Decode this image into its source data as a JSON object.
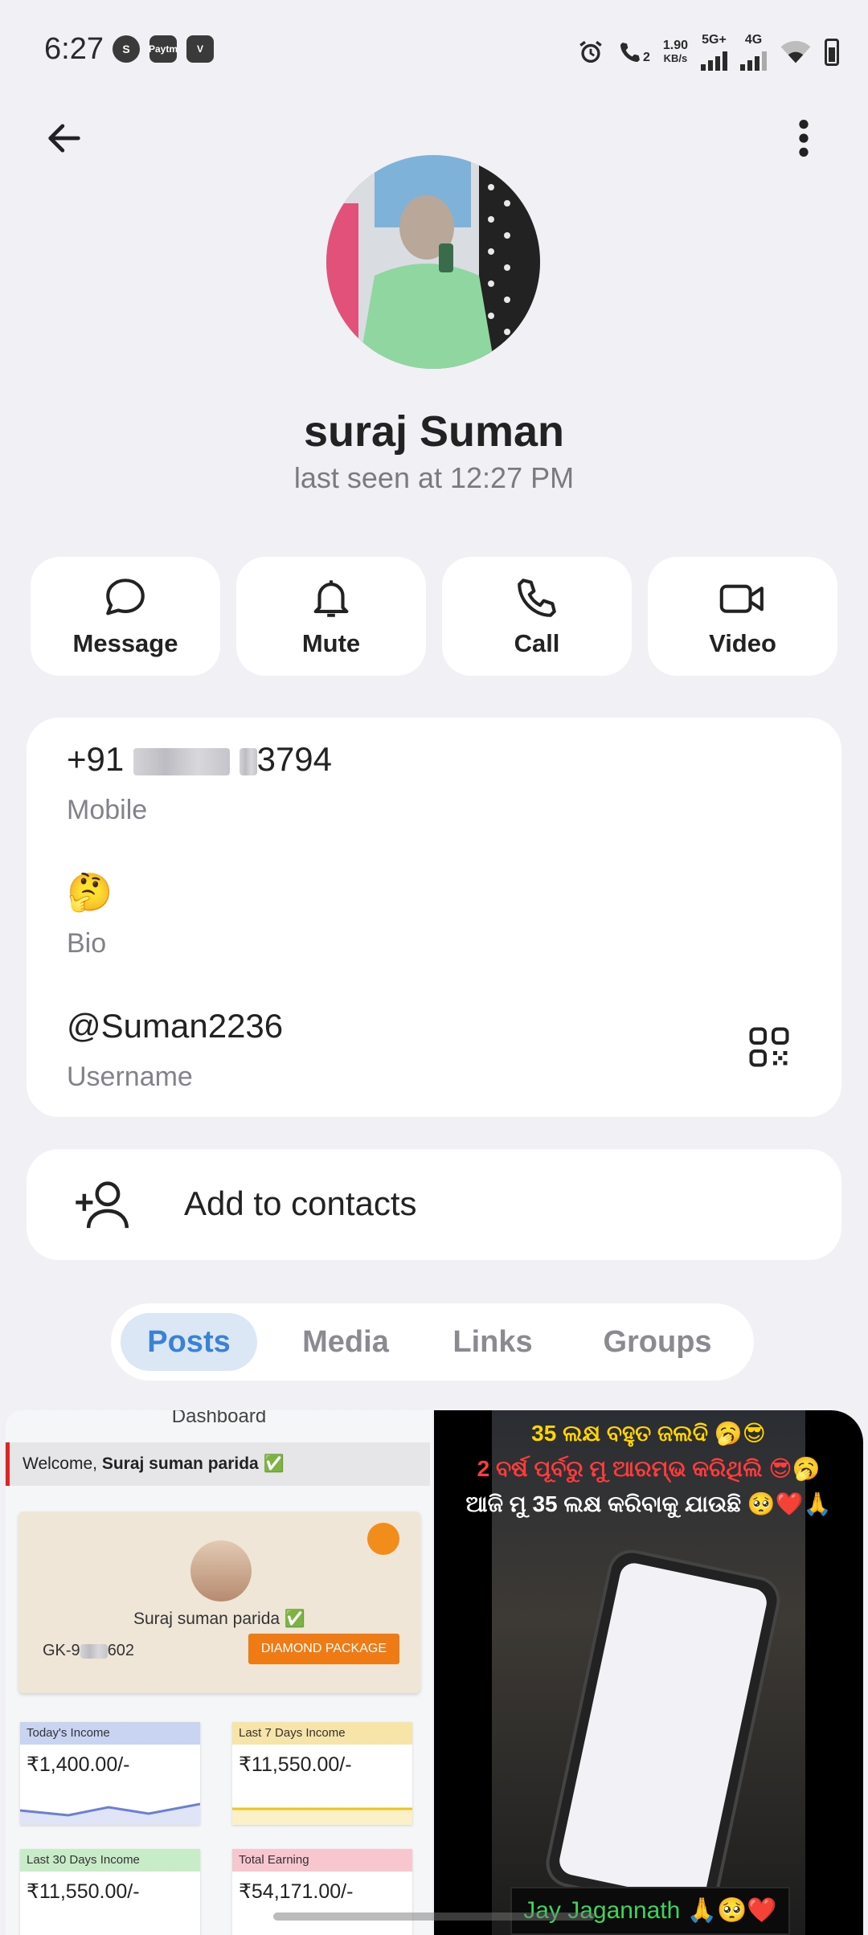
{
  "status_bar": {
    "time": "6:27",
    "notif_icons": [
      "S",
      "Paytm",
      "V"
    ],
    "call_sim": "2",
    "net_speed": "1.90",
    "net_unit": "KB/s",
    "net1": "5G+",
    "net2": "4G"
  },
  "profile": {
    "name": "suraj Suman",
    "last_seen": "last seen at 12:27 PM"
  },
  "actions": [
    {
      "label": "Message",
      "icon": "chat-bubble-icon"
    },
    {
      "label": "Mute",
      "icon": "bell-icon"
    },
    {
      "label": "Call",
      "icon": "phone-icon"
    },
    {
      "label": "Video",
      "icon": "video-camera-icon"
    }
  ],
  "info": {
    "phone_prefix": "+91",
    "phone_suffix": "3794",
    "phone_label": "Mobile",
    "bio_value": "🤔",
    "bio_label": "Bio",
    "username_value": "@Suman2236",
    "username_label": "Username"
  },
  "add_contact": {
    "label": "Add to contacts"
  },
  "tabs": [
    {
      "label": "Posts",
      "active": true
    },
    {
      "label": "Media",
      "active": false
    },
    {
      "label": "Links",
      "active": false
    },
    {
      "label": "Groups",
      "active": false
    }
  ],
  "post_left": {
    "title": "Dashboard",
    "welcome_prefix": "Welcome,",
    "welcome_name": "Suraj suman parida",
    "welcome_check": "✅",
    "card_name": "Suraj suman parida ✅",
    "card_id": "GK-9",
    "card_id_suffix": "602",
    "package": "DIAMOND PACKAGE",
    "stats": [
      {
        "label": "Today's Income",
        "value": "₹1,400.00/-",
        "color": "#c9d3f2",
        "line": "#6b7fd6"
      },
      {
        "label": "Last 7 Days Income",
        "value": "₹11,550.00/-",
        "color": "#f7e4a8",
        "line": "#f0c419"
      },
      {
        "label": "Last 30 Days Income",
        "value": "₹11,550.00/-",
        "color": "#c8ecc8",
        "line": "#43b043"
      },
      {
        "label": "Total Earning",
        "value": "₹54,171.00/-",
        "color": "#f7c6cf",
        "line": "#e0455e"
      }
    ]
  },
  "post_right": {
    "line1": "35 ଲକ୍ଷ ବହୁତ ଜଲଦି 🥱😎",
    "line2": "2 ବର୍ଷ ପୂର୍ବରୁ ମୁ ଆରମ୍ଭ କରିଥିଲି 😎🥱",
    "line3": "ଆଜି ମୁ 35 ଲକ୍ଷ କରିବାକୁ ଯାଉଛି 🥺❤️🙏",
    "caption": "Jay Jagannath 🙏🥺❤️"
  }
}
